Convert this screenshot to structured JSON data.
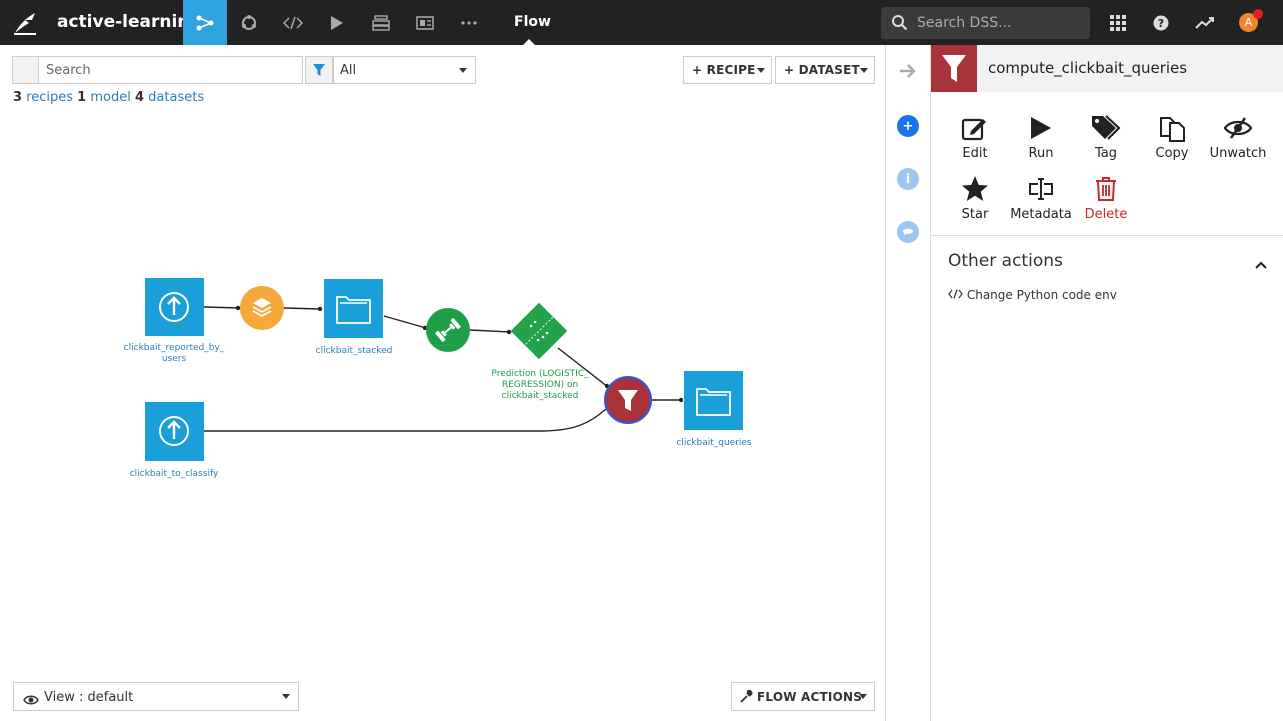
{
  "topbar": {
    "project_name": "active-learning",
    "current_view": "Flow",
    "search_placeholder": "Search DSS...",
    "avatar_initial": "A",
    "nav_icons": [
      "flow-icon",
      "lab-icon",
      "code-icon",
      "jobs-icon",
      "datasets-stack-icon",
      "dashboard-icon",
      "more-icon"
    ]
  },
  "toolbar": {
    "search_placeholder": "Search",
    "filter_value": "All",
    "recipe_label": "+ RECIPE",
    "dataset_label": "+ DATASET"
  },
  "counts": {
    "recipes_n": "3",
    "recipes_label": "recipes",
    "models_n": "1",
    "models_label": "model",
    "datasets_n": "4",
    "datasets_label": "datasets"
  },
  "flow": {
    "nodes": {
      "reported_label_line1": "clickbait_reported_by_",
      "reported_label_line2": "users",
      "stacked_label": "clickbait_stacked",
      "to_classify_label": "clickbait_to_classify",
      "prediction_label_line1": "Prediction (LOGISTIC_",
      "prediction_label_line2": "REGRESSION) on",
      "prediction_label_line3": "clickbait_stacked",
      "queries_label": "clickbait_queries"
    },
    "colors": {
      "dataset_blue": "#1a9fd8",
      "stack_orange": "#f5a93b",
      "train_green": "#1f9e4a",
      "model_green": "#22a24a",
      "python_red": "#a8343a"
    }
  },
  "bottom": {
    "view_label": "View : default",
    "flow_actions_label": "FLOW ACTIONS"
  },
  "panel": {
    "title": "compute_clickbait_queries",
    "actions": {
      "edit": "Edit",
      "run": "Run",
      "tag": "Tag",
      "copy": "Copy",
      "unwatch": "Unwatch",
      "star": "Star",
      "metadata": "Metadata",
      "delete": "Delete"
    },
    "other_actions_title": "Other actions",
    "change_env_label": "Change Python code env"
  }
}
